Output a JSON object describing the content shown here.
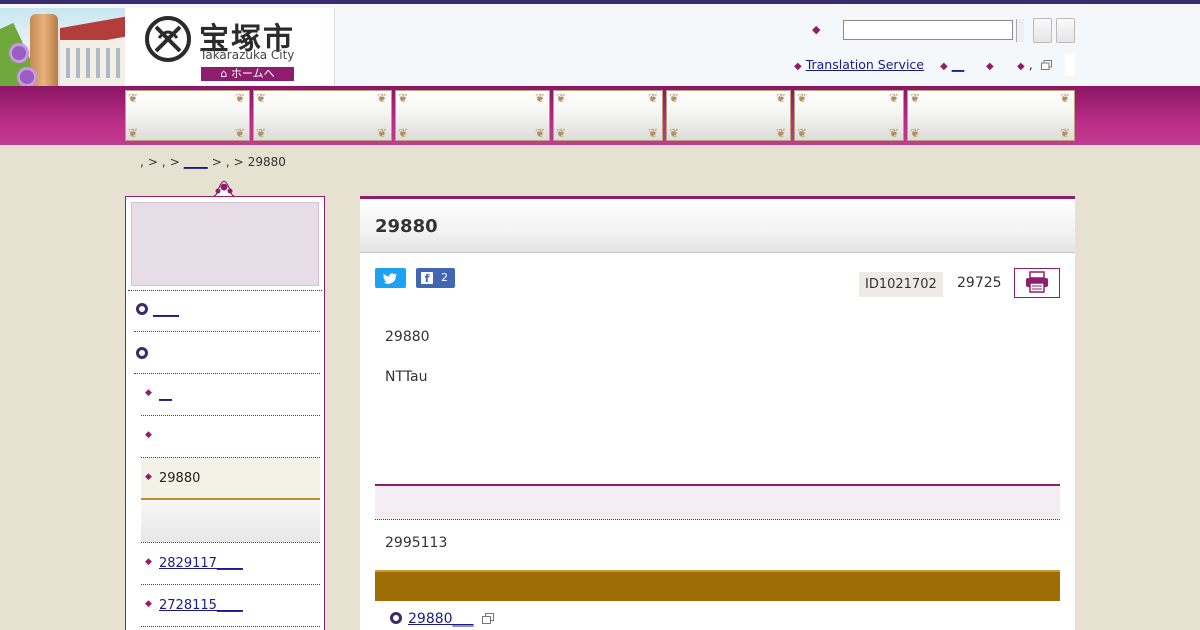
{
  "header": {
    "city_name": "宝塚市",
    "city_name_en": "Takarazuka City",
    "home_label": "ホームへ",
    "search": {
      "value": "",
      "placeholder": ""
    },
    "util_links": [
      {
        "label": "Translation Service",
        "is_link": true
      },
      {
        "label": "__",
        "is_link": true
      },
      {
        "label": "",
        "is_link": false
      },
      {
        "label": ",",
        "is_link": false
      }
    ]
  },
  "gnav": {
    "items": [
      {
        "label": ""
      },
      {
        "label": ""
      },
      {
        "label": ""
      },
      {
        "label": ""
      },
      {
        "label": ""
      },
      {
        "label": ""
      },
      {
        "label": ""
      }
    ]
  },
  "breadcrumb": {
    "items": [
      {
        "label": ",",
        "is_link": false
      },
      {
        "label": ">",
        "is_link": false
      },
      {
        "label": ",",
        "is_link": false
      },
      {
        "label": ">",
        "is_link": false
      },
      {
        "label": "____",
        "is_link": true
      },
      {
        "label": ">",
        "is_link": false
      },
      {
        "label": ",",
        "is_link": false
      },
      {
        "label": ">",
        "is_link": false
      },
      {
        "label": "29880",
        "is_link": false
      }
    ]
  },
  "sidebar": {
    "heading": "",
    "items": [
      {
        "label": "____",
        "level": 1,
        "is_link": true
      },
      {
        "label": "",
        "level": 1,
        "is_link": false
      },
      {
        "label": "__",
        "level": 2,
        "is_link": true
      },
      {
        "label": "",
        "level": 2,
        "is_link": false
      },
      {
        "label": "29880",
        "level": 2,
        "is_link": false,
        "current": true
      },
      {
        "label": "2829117____",
        "level": 2,
        "is_link": true
      },
      {
        "label": "2728115____",
        "level": 2,
        "is_link": true
      }
    ]
  },
  "main": {
    "title": "29880",
    "facebook_count": "2",
    "page_id": "ID1021702",
    "date": "29725",
    "paragraphs": [
      "29880",
      "NTTau"
    ],
    "contact_heading": "",
    "contact_text": "2995113",
    "related_heading": "",
    "related_link": "29880___"
  },
  "colors": {
    "accent": "#8f1d6d",
    "navy": "#3a2a6e",
    "gold": "#9e6e04",
    "background": "#e6e1d1"
  }
}
